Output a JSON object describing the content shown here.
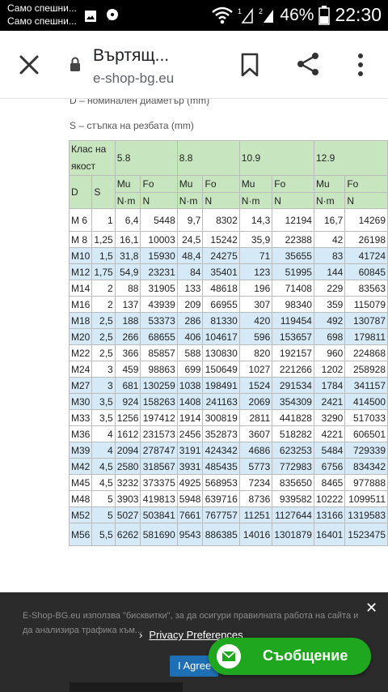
{
  "status_bar": {
    "notifications": [
      "Само спешни...",
      "Само спешни..."
    ],
    "battery_percent": "46%",
    "time": "22:30"
  },
  "toolbar": {
    "page_title": "Въртящ...",
    "domain": "e-shop-bg.eu"
  },
  "content": {
    "note_d": "D – номинален диаметър (mm)",
    "note_s": "S – стъпка на резбата (mm)",
    "table": {
      "class_header": "Клас на якост",
      "classes": [
        "5.8",
        "8.8",
        "10.9",
        "12.9"
      ],
      "col_d": "D",
      "col_s": "S",
      "col_mu": "Mu",
      "col_fo": "Fo",
      "unit_mu": "N·m",
      "unit_fo": "N",
      "rows": [
        {
          "d": "M 6",
          "s": "1",
          "v": [
            "6,4",
            "5448",
            "9,7",
            "8302",
            "14,3",
            "12194",
            "16,7",
            "14269"
          ]
        },
        {
          "d": "M 8",
          "s": "1,25",
          "v": [
            "16,1",
            "10003",
            "24,5",
            "15242",
            "35,9",
            "22388",
            "42",
            "26198"
          ]
        },
        {
          "d": "M10",
          "s": "1,5",
          "v": [
            "31,8",
            "15930",
            "48,4",
            "24275",
            "71",
            "35655",
            "83",
            "41724"
          ]
        },
        {
          "d": "M12",
          "s": "1,75",
          "v": [
            "54,9",
            "23231",
            "84",
            "35401",
            "123",
            "51995",
            "144",
            "60845"
          ]
        },
        {
          "d": "M14",
          "s": "2",
          "v": [
            "88",
            "31905",
            "133",
            "48618",
            "196",
            "71408",
            "229",
            "83563"
          ]
        },
        {
          "d": "M16",
          "s": "2",
          "v": [
            "137",
            "43939",
            "209",
            "66955",
            "307",
            "98340",
            "359",
            "115079"
          ]
        },
        {
          "d": "M18",
          "s": "2,5",
          "v": [
            "188",
            "53373",
            "286",
            "81330",
            "420",
            "119454",
            "492",
            "130787"
          ]
        },
        {
          "d": "M20",
          "s": "2,5",
          "v": [
            "266",
            "68655",
            "406",
            "104617",
            "596",
            "153657",
            "698",
            "179811"
          ]
        },
        {
          "d": "M22",
          "s": "2,5",
          "v": [
            "366",
            "85857",
            "588",
            "130830",
            "820",
            "192157",
            "960",
            "224868"
          ]
        },
        {
          "d": "M24",
          "s": "3",
          "v": [
            "459",
            "98863",
            "699",
            "150649",
            "1027",
            "221266",
            "1202",
            "258928"
          ]
        },
        {
          "d": "M27",
          "s": "3",
          "v": [
            "681",
            "130259",
            "1038",
            "198491",
            "1524",
            "291534",
            "1784",
            "341157"
          ]
        },
        {
          "d": "M30",
          "s": "3,5",
          "v": [
            "924",
            "158263",
            "1408",
            "241163",
            "2069",
            "354309",
            "2421",
            "414500"
          ]
        },
        {
          "d": "M33",
          "s": "3,5",
          "v": [
            "1256",
            "197412",
            "1914",
            "300819",
            "2811",
            "441828",
            "3290",
            "517033"
          ]
        },
        {
          "d": "M36",
          "s": "4",
          "v": [
            "1612",
            "231573",
            "2456",
            "352873",
            "3607",
            "518282",
            "4221",
            "606501"
          ]
        },
        {
          "d": "M39",
          "s": "4",
          "v": [
            "2094",
            "278747",
            "3191",
            "424342",
            "4686",
            "623253",
            "5484",
            "729339"
          ]
        },
        {
          "d": "M42",
          "s": "4,5",
          "v": [
            "2580",
            "318567",
            "3931",
            "485435",
            "5773",
            "772983",
            "6756",
            "834342"
          ]
        },
        {
          "d": "M45",
          "s": "4,5",
          "v": [
            "3232",
            "373375",
            "4925",
            "568953",
            "7234",
            "835650",
            "8465",
            "977888"
          ]
        },
        {
          "d": "M48",
          "s": "5",
          "v": [
            "3903",
            "419813",
            "5948",
            "639716",
            "8736",
            "939582",
            "10222",
            "1099511"
          ]
        },
        {
          "d": "M52",
          "s": "5",
          "v": [
            "5027",
            "503841",
            "7661",
            "767757",
            "11251",
            "1127644",
            "13166",
            "1319583"
          ]
        },
        {
          "d": "M56",
          "s": "5,5",
          "v": [
            "6262",
            "581690",
            "9543",
            "886385",
            "14016",
            "1301879",
            "16401",
            "1523475"
          ]
        }
      ]
    }
  },
  "cookie_banner": {
    "text": "E-Shop-BG.eu използва \"бисквитки\", за да осигури правилната работа на сайта и да анализира трафика към...",
    "privacy_label": "Privacy Preferences",
    "agree_label": "I Agree"
  },
  "message_button": {
    "label": "Съобщение"
  },
  "colors": {
    "header_green": "#c7e6c0",
    "row_blue": "#d5e9f7",
    "fab_green": "#1fa81f",
    "agree_blue": "#1f6fb4"
  }
}
